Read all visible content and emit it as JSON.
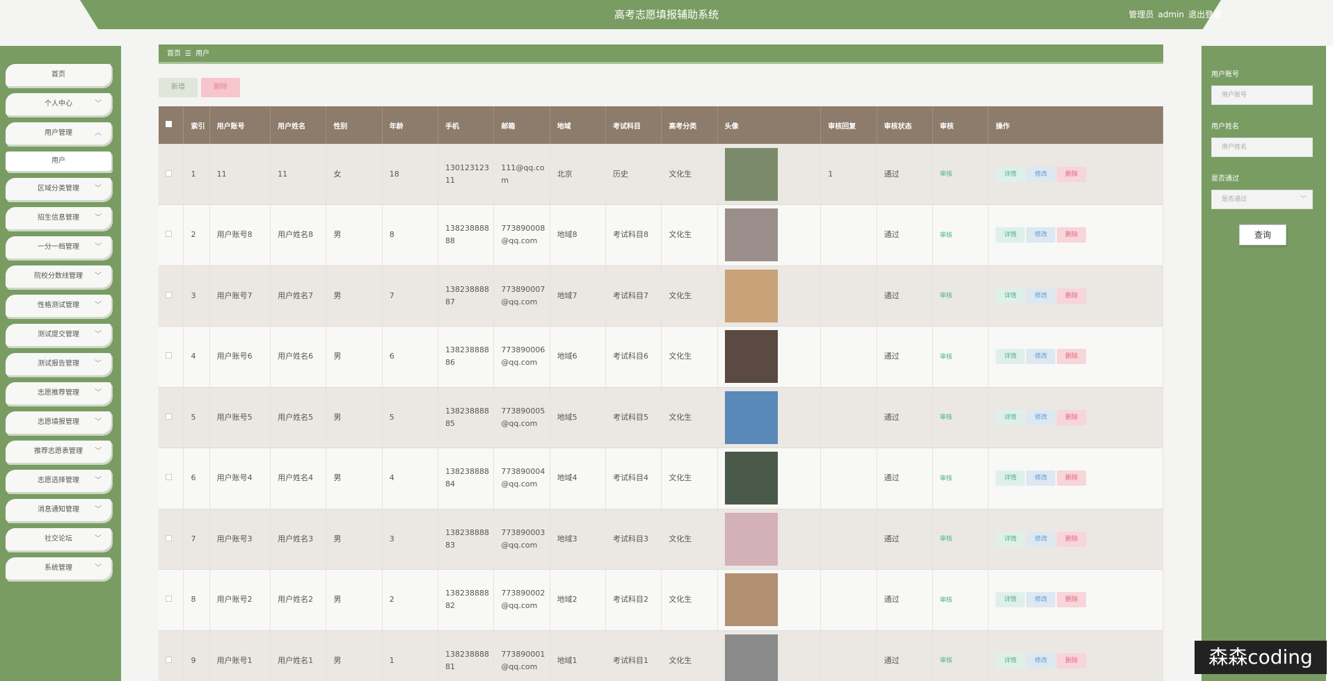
{
  "header": {
    "title": "高考志愿填报辅助系统",
    "role": "管理员",
    "username": "admin",
    "logout": "退出登录"
  },
  "menu": [
    {
      "label": "首页",
      "arrow": ""
    },
    {
      "label": "个人中心",
      "arrow": "﹀"
    },
    {
      "label": "用户管理",
      "arrow": "︿"
    },
    {
      "label": "用户",
      "arrow": "",
      "sub": true
    },
    {
      "label": "区域分类管理",
      "arrow": "﹀"
    },
    {
      "label": "招生信息管理",
      "arrow": "﹀"
    },
    {
      "label": "一分一档管理",
      "arrow": "﹀"
    },
    {
      "label": "院校分数线管理",
      "arrow": "﹀"
    },
    {
      "label": "性格测试管理",
      "arrow": "﹀"
    },
    {
      "label": "测试提交管理",
      "arrow": "﹀"
    },
    {
      "label": "测试报告管理",
      "arrow": "﹀"
    },
    {
      "label": "志愿推荐管理",
      "arrow": "﹀"
    },
    {
      "label": "志愿填报管理",
      "arrow": "﹀"
    },
    {
      "label": "推荐志愿表管理",
      "arrow": "﹀"
    },
    {
      "label": "志愿选择管理",
      "arrow": "﹀"
    },
    {
      "label": "消息通知管理",
      "arrow": "﹀"
    },
    {
      "label": "社交论坛",
      "arrow": "﹀"
    },
    {
      "label": "系统管理",
      "arrow": "﹀"
    }
  ],
  "breadcrumb": {
    "home": "首页",
    "sep": "☰",
    "current": "用户"
  },
  "actions": {
    "add": "新增",
    "delete": "删除"
  },
  "table": {
    "columns": [
      "",
      "索引",
      "用户账号",
      "用户姓名",
      "性别",
      "年龄",
      "手机",
      "邮箱",
      "地域",
      "考试科目",
      "高考分类",
      "头像",
      "审核回复",
      "审核状态",
      "审核",
      "操作"
    ],
    "rows": [
      {
        "idx": "1",
        "account": "11",
        "name": "11",
        "gender": "女",
        "age": "18",
        "phone": "13012312311",
        "email": "111@qq.com",
        "region": "北京",
        "subject": "历史",
        "category": "文化生",
        "reply": "1",
        "status": "通过",
        "audit": "审核",
        "avatar_color": "#7a8a6a"
      },
      {
        "idx": "2",
        "account": "用户账号8",
        "name": "用户姓名8",
        "gender": "男",
        "age": "8",
        "phone": "13823888888",
        "email": "773890008@qq.com",
        "region": "地域8",
        "subject": "考试科目8",
        "category": "文化生",
        "reply": "",
        "status": "通过",
        "audit": "审核",
        "avatar_color": "#9a8f8a"
      },
      {
        "idx": "3",
        "account": "用户账号7",
        "name": "用户姓名7",
        "gender": "男",
        "age": "7",
        "phone": "13823888887",
        "email": "773890007@qq.com",
        "region": "地域7",
        "subject": "考试科目7",
        "category": "文化生",
        "reply": "",
        "status": "通过",
        "audit": "审核",
        "avatar_color": "#c9a27a"
      },
      {
        "idx": "4",
        "account": "用户账号6",
        "name": "用户姓名6",
        "gender": "男",
        "age": "6",
        "phone": "13823888886",
        "email": "773890006@qq.com",
        "region": "地域6",
        "subject": "考试科目6",
        "category": "文化生",
        "reply": "",
        "status": "通过",
        "audit": "审核",
        "avatar_color": "#5a4a42"
      },
      {
        "idx": "5",
        "account": "用户账号5",
        "name": "用户姓名5",
        "gender": "男",
        "age": "5",
        "phone": "13823888885",
        "email": "773890005@qq.com",
        "region": "地域5",
        "subject": "考试科目5",
        "category": "文化生",
        "reply": "",
        "status": "通过",
        "audit": "审核",
        "avatar_color": "#5a88b8"
      },
      {
        "idx": "6",
        "account": "用户账号4",
        "name": "用户姓名4",
        "gender": "男",
        "age": "4",
        "phone": "13823888884",
        "email": "773890004@qq.com",
        "region": "地域4",
        "subject": "考试科目4",
        "category": "文化生",
        "reply": "",
        "status": "通过",
        "audit": "审核",
        "avatar_color": "#4a5a4a"
      },
      {
        "idx": "7",
        "account": "用户账号3",
        "name": "用户姓名3",
        "gender": "男",
        "age": "3",
        "phone": "13823888883",
        "email": "773890003@qq.com",
        "region": "地域3",
        "subject": "考试科目3",
        "category": "文化生",
        "reply": "",
        "status": "通过",
        "audit": "审核",
        "avatar_color": "#d4b0b8"
      },
      {
        "idx": "8",
        "account": "用户账号2",
        "name": "用户姓名2",
        "gender": "男",
        "age": "2",
        "phone": "13823888882",
        "email": "773890002@qq.com",
        "region": "地域2",
        "subject": "考试科目2",
        "category": "文化生",
        "reply": "",
        "status": "通过",
        "audit": "审核",
        "avatar_color": "#b09070"
      },
      {
        "idx": "9",
        "account": "用户账号1",
        "name": "用户姓名1",
        "gender": "男",
        "age": "1",
        "phone": "13823888881",
        "email": "773890001@qq.com",
        "region": "地域1",
        "subject": "考试科目1",
        "category": "文化生",
        "reply": "",
        "status": "通过",
        "audit": "审核",
        "avatar_color": "#8a8a8a"
      }
    ],
    "ops": {
      "detail": "详情",
      "edit": "修改",
      "delete": "删除"
    }
  },
  "search": {
    "account_label": "用户账号",
    "account_placeholder": "用户账号",
    "name_label": "用户姓名",
    "name_placeholder": "用户姓名",
    "pass_label": "是否通过",
    "pass_placeholder": "是否通过",
    "button": "查询"
  },
  "watermark": "森森coding",
  "colors": {
    "theme": "#789c62",
    "table_header": "#8d7b6b"
  }
}
